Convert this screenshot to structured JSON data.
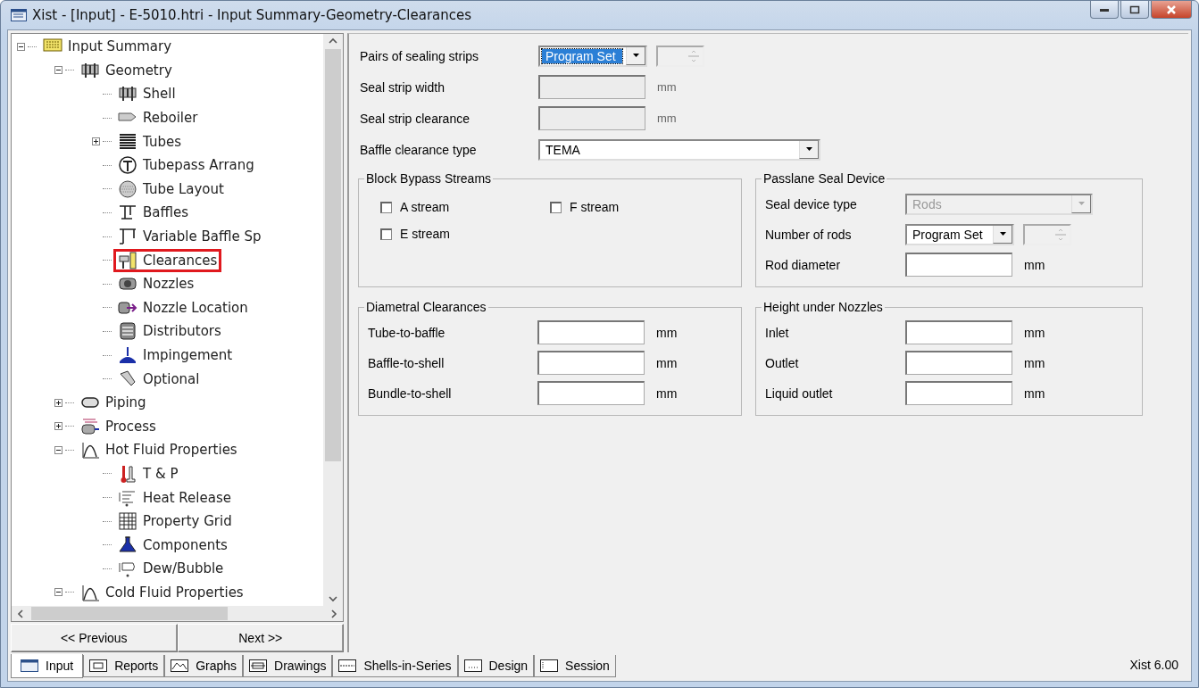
{
  "window": {
    "title": "Xist - [Input] - E-5010.htri - Input Summary-Geometry-Clearances"
  },
  "tree": {
    "items": [
      {
        "label": "Input Summary",
        "expanded": true,
        "marked": false,
        "children": [
          {
            "label": "Geometry",
            "expanded": true,
            "marked": false,
            "children": [
              {
                "label": "Shell",
                "marked": false
              },
              {
                "label": "Reboiler",
                "marked": false
              },
              {
                "label": "Tubes",
                "expanded": false,
                "marked": false
              },
              {
                "label": "Tubepass Arrang",
                "marked": false
              },
              {
                "label": "Tube Layout",
                "marked": false
              },
              {
                "label": "Baffles",
                "marked": false
              },
              {
                "label": "Variable Baffle Sp",
                "marked": false
              },
              {
                "label": "Clearances",
                "marked": true
              },
              {
                "label": "Nozzles",
                "marked": false
              },
              {
                "label": "Nozzle Location",
                "marked": false
              },
              {
                "label": "Distributors",
                "marked": false
              },
              {
                "label": "Impingement",
                "marked": false
              },
              {
                "label": "Optional",
                "marked": false
              }
            ]
          },
          {
            "label": "Piping",
            "expanded": false,
            "marked": false
          },
          {
            "label": "Process",
            "expanded": false,
            "marked": false
          },
          {
            "label": "Hot Fluid Properties",
            "expanded": true,
            "marked": false,
            "children": [
              {
                "label": "T & P",
                "marked": false
              },
              {
                "label": "Heat Release",
                "marked": false
              },
              {
                "label": "Property Grid",
                "marked": false
              },
              {
                "label": "Components",
                "marked": false
              },
              {
                "label": "Dew/Bubble",
                "marked": false
              }
            ]
          },
          {
            "label": "Cold Fluid Properties",
            "expanded": true,
            "marked": false
          }
        ]
      }
    ]
  },
  "nav_buttons": [
    "<< Previous",
    "Next >>"
  ],
  "form": {
    "rows": [
      {
        "kind": "combo-spin",
        "label": "Pairs of sealing strips",
        "value": "Program Set",
        "focused": true,
        "disabled": false
      },
      {
        "kind": "text",
        "label": "Seal strip width",
        "unit": "mm",
        "disabled": true
      },
      {
        "kind": "text",
        "label": "Seal strip clearance",
        "unit": "mm",
        "disabled": true
      },
      {
        "kind": "combo-wide",
        "label": "Baffle clearance type",
        "value": "TEMA",
        "focused": false,
        "disabled": false
      }
    ],
    "groups": [
      {
        "title": "Block Bypass Streams",
        "checkboxes": [
          {
            "label": "A stream",
            "checked": false
          },
          {
            "label": "F stream",
            "checked": false
          },
          {
            "label": "E stream",
            "checked": false
          }
        ]
      },
      {
        "title": "Passlane Seal Device",
        "rows": [
          {
            "kind": "combo-long",
            "label": "Seal device type",
            "value": "Rods",
            "focused": false,
            "disabled": true
          },
          {
            "kind": "combo-spin",
            "label": "Number of rods",
            "value": "Program Set",
            "focused": false,
            "disabled": false
          },
          {
            "kind": "text",
            "label": "Rod diameter",
            "unit": "mm",
            "disabled": false
          }
        ]
      },
      {
        "title": "Diametral Clearances",
        "rows": [
          {
            "kind": "text",
            "label": "Tube-to-baffle",
            "unit": "mm",
            "disabled": false
          },
          {
            "kind": "text",
            "label": "Baffle-to-shell",
            "unit": "mm",
            "disabled": false
          },
          {
            "kind": "text",
            "label": "Bundle-to-shell",
            "unit": "mm",
            "disabled": false
          }
        ]
      },
      {
        "title": "Height under Nozzles",
        "rows": [
          {
            "kind": "text",
            "label": "Inlet",
            "unit": "mm",
            "disabled": false
          },
          {
            "kind": "text",
            "label": "Outlet",
            "unit": "mm",
            "disabled": false
          },
          {
            "kind": "text",
            "label": "Liquid outlet",
            "unit": "mm",
            "disabled": false
          }
        ]
      }
    ]
  },
  "tabs": [
    {
      "label": "Input",
      "selected": true
    },
    {
      "label": "Reports",
      "selected": false
    },
    {
      "label": "Graphs",
      "selected": false
    },
    {
      "label": "Drawings",
      "selected": false
    },
    {
      "label": "Shells-in-Series",
      "selected": false
    },
    {
      "label": "Design",
      "selected": false
    },
    {
      "label": "Session",
      "selected": false
    }
  ],
  "status": "Xist 6.00"
}
